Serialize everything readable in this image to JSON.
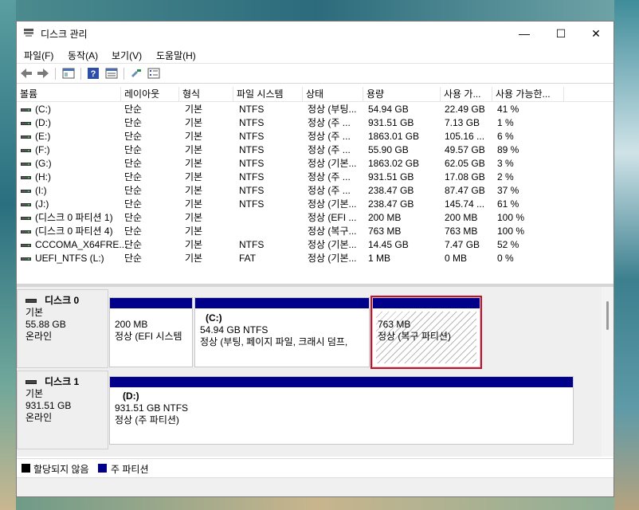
{
  "window": {
    "title": "디스크 관리",
    "minimize_glyph": "—",
    "maximize_glyph": "☐",
    "close_glyph": "✕"
  },
  "menu": [
    "파일(F)",
    "동작(A)",
    "보기(V)",
    "도움말(H)"
  ],
  "toolbar_icons": [
    "back-icon",
    "forward-icon",
    "console-tree-icon",
    "help-icon",
    "properties-icon",
    "show-hide-icon",
    "list-icon"
  ],
  "columns": [
    "볼륨",
    "레이아웃",
    "형식",
    "파일 시스템",
    "상태",
    "용량",
    "사용 가...",
    "사용 가능한..."
  ],
  "volumes": [
    [
      "(C:)",
      "단순",
      "기본",
      "NTFS",
      "정상 (부팅...",
      "54.94 GB",
      "22.49 GB",
      "41 %"
    ],
    [
      "(D:)",
      "단순",
      "기본",
      "NTFS",
      "정상 (주 ...",
      "931.51 GB",
      "7.13 GB",
      "1 %"
    ],
    [
      "(E:)",
      "단순",
      "기본",
      "NTFS",
      "정상 (주 ...",
      "1863.01 GB",
      "105.16 ...",
      "6 %"
    ],
    [
      "(F:)",
      "단순",
      "기본",
      "NTFS",
      "정상 (주 ...",
      "55.90 GB",
      "49.57 GB",
      "89 %"
    ],
    [
      "(G:)",
      "단순",
      "기본",
      "NTFS",
      "정상 (기본...",
      "1863.02 GB",
      "62.05 GB",
      "3 %"
    ],
    [
      "(H:)",
      "단순",
      "기본",
      "NTFS",
      "정상 (주 ...",
      "931.51 GB",
      "17.08 GB",
      "2 %"
    ],
    [
      "(I:)",
      "단순",
      "기본",
      "NTFS",
      "정상 (주 ...",
      "238.47 GB",
      "87.47 GB",
      "37 %"
    ],
    [
      "(J:)",
      "단순",
      "기본",
      "NTFS",
      "정상 (기본...",
      "238.47 GB",
      "145.74 ...",
      "61 %"
    ],
    [
      "(디스크 0 파티션 1)",
      "단순",
      "기본",
      "",
      "정상 (EFI ...",
      "200 MB",
      "200 MB",
      "100 %"
    ],
    [
      "(디스크 0 파티션 4)",
      "단순",
      "기본",
      "",
      "정상 (복구...",
      "763 MB",
      "763 MB",
      "100 %"
    ],
    [
      "CCCOMA_X64FRE...",
      "단순",
      "기본",
      "NTFS",
      "정상 (기본...",
      "14.45 GB",
      "7.47 GB",
      "52 %"
    ],
    [
      "UEFI_NTFS (L:)",
      "단순",
      "기본",
      "FAT",
      "정상 (기본...",
      "1 MB",
      "0 MB",
      "0 %"
    ]
  ],
  "disks": [
    {
      "name": "디스크 0",
      "type": "기본",
      "size": "55.88 GB",
      "status": "온라인",
      "partitions": [
        {
          "title": "",
          "size": "200 MB",
          "status": "정상 (EFI 시스템"
        },
        {
          "title": "(C:)",
          "size": "54.94 GB NTFS",
          "status": "정상 (부팅, 페이지 파일, 크래시 덤프,"
        },
        {
          "title": "",
          "size": "763 MB",
          "status": "정상 (복구 파티션)"
        }
      ]
    },
    {
      "name": "디스크 1",
      "type": "기본",
      "size": "931.51 GB",
      "status": "온라인",
      "partitions": [
        {
          "title": "(D:)",
          "size": "931.51 GB NTFS",
          "status": "정상 (주 파티션)"
        }
      ]
    }
  ],
  "legend": [
    {
      "label": "할당되지 않음",
      "color": "#000000"
    },
    {
      "label": "주 파티션",
      "color": "#00008b"
    }
  ],
  "colors": {
    "primary_partition": "#00008b",
    "selection": "#c8102e"
  }
}
